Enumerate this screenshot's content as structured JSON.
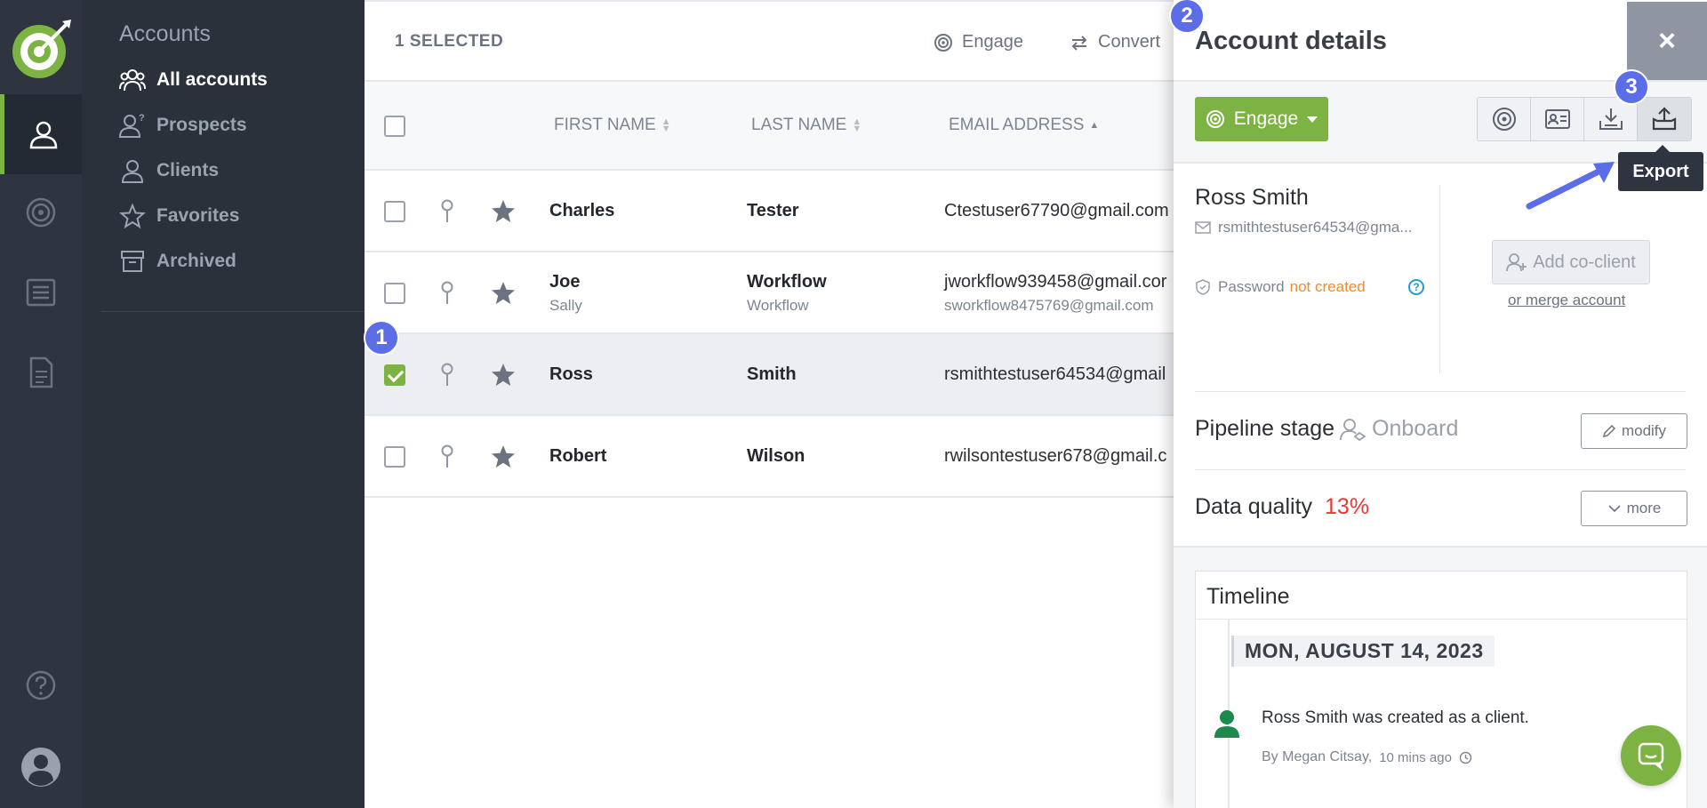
{
  "sidebar": {
    "title": "Accounts",
    "items": [
      {
        "label": "All accounts"
      },
      {
        "label": "Prospects"
      },
      {
        "label": "Clients"
      },
      {
        "label": "Favorites"
      },
      {
        "label": "Archived"
      }
    ]
  },
  "topbar": {
    "selected_count": "1 SELECTED",
    "engage_label": "Engage",
    "convert_label": "Convert"
  },
  "table": {
    "columns": [
      "FIRST NAME",
      "LAST NAME",
      "EMAIL ADDRESS"
    ],
    "rows": [
      {
        "first": "Charles",
        "first_sub": "",
        "last": "Tester",
        "last_sub": "",
        "email": "Ctestuser67790@gmail.com",
        "email_sub": "",
        "selected": false
      },
      {
        "first": "Joe",
        "first_sub": "Sally",
        "last": "Workflow",
        "last_sub": "Workflow",
        "email": "jworkflow939458@gmail.cor",
        "email_sub": "sworkflow8475769@gmail.com",
        "selected": false
      },
      {
        "first": "Ross",
        "first_sub": "",
        "last": "Smith",
        "last_sub": "",
        "email": "rsmithtestuser64534@gmail",
        "email_sub": "",
        "selected": true
      },
      {
        "first": "Robert",
        "first_sub": "",
        "last": "Wilson",
        "last_sub": "",
        "email": "rwilsontestuser678@gmail.c",
        "email_sub": "",
        "selected": false
      }
    ]
  },
  "badges": {
    "one": "1",
    "two": "2",
    "three": "3"
  },
  "panel": {
    "title": "Account details",
    "close_label": "×",
    "engage_label": "Engage",
    "tooltip": "Export",
    "contact_name": "Ross Smith",
    "contact_email": "rsmithtestuser64534@gma...",
    "password_label": "Password",
    "password_status": "not created",
    "help_label": "?",
    "add_coclient_label": "Add co-client",
    "merge_label": "or merge account",
    "pipeline_label": "Pipeline stage",
    "pipeline_value": "Onboard",
    "modify_label": "modify",
    "data_quality_label": "Data quality",
    "data_quality_value": "13%",
    "more_label": "more",
    "timeline": {
      "title": "Timeline",
      "date": "MON, AUGUST 14, 2023",
      "event": "Ross Smith was created as a client.",
      "author": "By Megan Citsay,",
      "time": "10 mins ago"
    }
  },
  "colors": {
    "accent_green": "#7cb342",
    "rail_bg": "#2f3540",
    "badge_blue": "#5b6ee8",
    "warning_orange": "#f28c28",
    "danger_red": "#e53935"
  }
}
